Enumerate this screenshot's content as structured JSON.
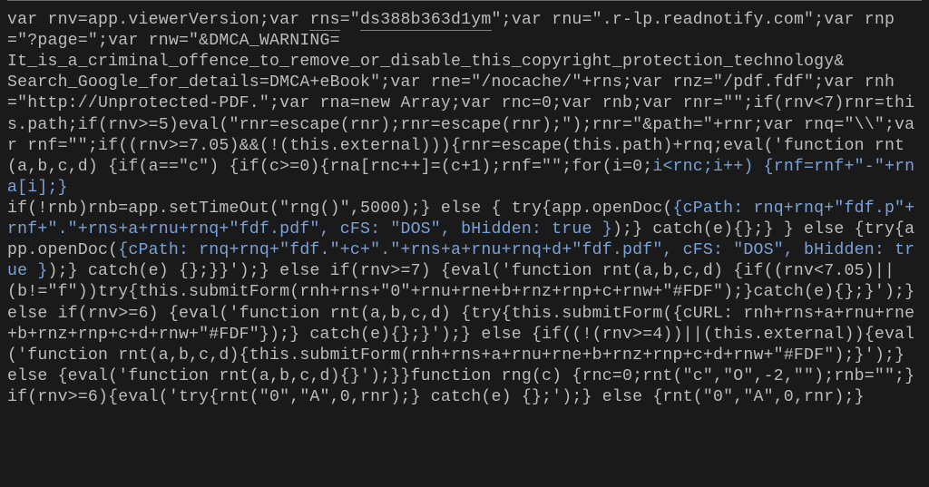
{
  "code": {
    "underline_rns": "rns",
    "underline_val": "ds388b363d1ym",
    "line1a": "var rnv=app.viewerVersion;var ",
    "line1b": "=\"",
    "line1c": "\";var rnu=\".r-lp.readnotify.com\";var rnp=\"?page=\";var rnw=\"&DMCA_WARNING=",
    "line2": "It_is_a_criminal_offence_to_remove_or_disable_this_copyright_protection_technology&",
    "line3": "Search_Google_for_details=DMCA+eBook\";var rne=\"/nocache/\"+rns;var rnz=\"/pdf.fdf\";var rnh=\"http://Unprotected-PDF.\";var rna=new Array;var rnc=0;var rnb;var rnr=\"\";if(rnv<7)rnr=this.path;if(rnv>=5)eval(\"rnr=escape(rnr);rnr=escape(rnr);\");rnr=\"&path=\"+rnr;var rnq=\"\\\\\";var rnf=\"\";if((rnv>=7.05)&&(!(this.external))){rnr=escape(this.path)+rnq;eval('function rnt(a,b,c,d) {if(a==\"c\") {if(c>=0){rna[rnc++]=(c+1);rnf=\"\";for(i=0;",
    "blue1": "i<rnc;i++) {rnf=rnf+\"-\"+rna[i];}",
    "line4a": "if(!rnb)rnb=app.setTimeOut(\"rng()\",5000);} else { try{app.openDoc(",
    "blue2": "{cPath: rnq+rnq+\"fdf.p\"+rnf+\".\"+rns+a+rnu+rnq+\"fdf.pdf\", cFS: \"DOS\", bHidden: true }",
    "line4b": ");} catch(e){};} } else {try{app.openDoc(",
    "blue3": "{cPath: rnq+rnq+\"fdf.\"+c+\".\"+rns+a+rnu+rnq+d+\"fdf.pdf\", cFS: \"DOS\", bHidden: true }",
    "line5": ");} catch(e) {};}}');} else if(rnv>=7) {eval('function rnt(a,b,c,d) {if((rnv<7.05)||(b!=\"f\"))try{this.submitForm(rnh+rns+\"0\"+rnu+rne+b+rnz+rnp+c+rnw+\"#FDF\");}catch(e){};}');} else if(rnv>=6) {eval('function rnt(a,b,c,d) {try{this.submitForm({cURL: rnh+rns+a+rnu+rne+b+rnz+rnp+c+d+rnw+\"#FDF\"});} catch(e){};}');} else {if((!(rnv>=4))||(this.external)){eval('function rnt(a,b,c,d){this.submitForm(rnh+rns+a+rnu+rne+b+rnz+rnp+c+d+rnw+\"#FDF\");}');} else {eval('function rnt(a,b,c,d){}');}}function rng(c) {rnc=0;rnt(\"c\",\"O\",-2,\"\");rnb=\"\";}if(rnv>=6){eval('try{rnt(\"0\",\"A\",0,rnr);} catch(e) {};');} else {rnt(\"0\",\"A\",0,rnr);}"
  }
}
